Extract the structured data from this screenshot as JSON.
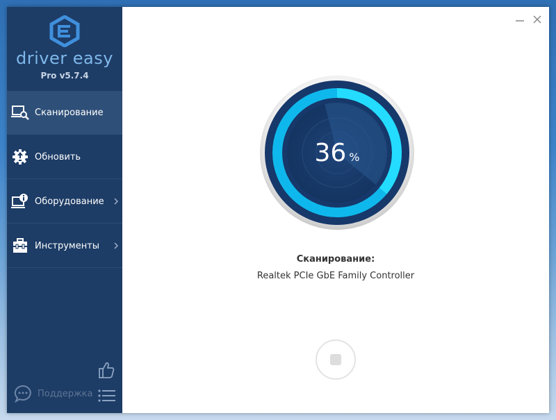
{
  "app": {
    "logo_text": "driver easy",
    "version": "Pro v5.7.4"
  },
  "sidebar": {
    "items": [
      {
        "label": "Сканирование",
        "icon": "scan-icon",
        "active": true
      },
      {
        "label": "Обновить",
        "icon": "update-gear-icon",
        "active": false
      },
      {
        "label": "Оборудование",
        "icon": "hardware-info-icon",
        "active": false,
        "has_submenu": true
      },
      {
        "label": "Инструменты",
        "icon": "toolbox-icon",
        "active": false,
        "has_submenu": true
      }
    ],
    "support_label": "Поддержка"
  },
  "scan": {
    "progress_value": "36",
    "progress_unit": "%",
    "progress_fraction": 0.36,
    "status_title": "Сканирование:",
    "current_device": "Realtek PCIe GbE Family Controller"
  },
  "colors": {
    "sidebar_bg": "#1d3c66",
    "sidebar_active": "#2e4f78",
    "accent_cyan": "#12c8f0",
    "gauge_dark": "#17386a"
  }
}
